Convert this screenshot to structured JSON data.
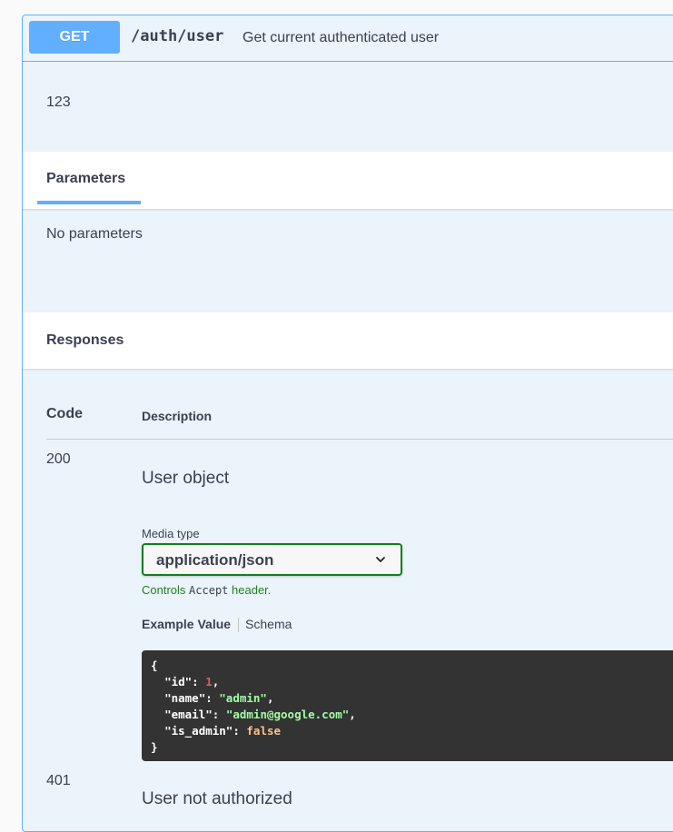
{
  "operation": {
    "method": "GET",
    "path": "/auth/user",
    "summary": "Get current authenticated user",
    "description": "123"
  },
  "parameters": {
    "tab_label": "Parameters",
    "empty_text": "No parameters"
  },
  "responses": {
    "tab_label": "Responses",
    "header_code": "Code",
    "header_description": "Description",
    "items": [
      {
        "code": "200",
        "description": "User object",
        "media_type_label": "Media type",
        "media_type_value": "application/json",
        "controls_prefix": "Controls",
        "controls_code": "Accept",
        "controls_suffix": "header.",
        "example_tab": "Example Value",
        "schema_tab": "Schema",
        "example": {
          "open": "{",
          "lines": [
            {
              "key": "\"id\"",
              "value": "1",
              "type": "number",
              "trail": ","
            },
            {
              "key": "\"name\"",
              "value": "\"admin\"",
              "type": "string",
              "trail": ","
            },
            {
              "key": "\"email\"",
              "value": "\"admin@google.com\"",
              "type": "string",
              "trail": ","
            },
            {
              "key": "\"is_admin\"",
              "value": "false",
              "type": "boolean",
              "trail": ""
            }
          ],
          "close": "}"
        }
      },
      {
        "code": "401",
        "description": "User not authorized"
      }
    ]
  },
  "colors": {
    "get_accent": "#61affe",
    "block_bg": "#ebf3fb",
    "valid_green": "#137e1e",
    "code_bg": "#333333"
  },
  "icons": {
    "media_select": "chevron-down-icon"
  }
}
